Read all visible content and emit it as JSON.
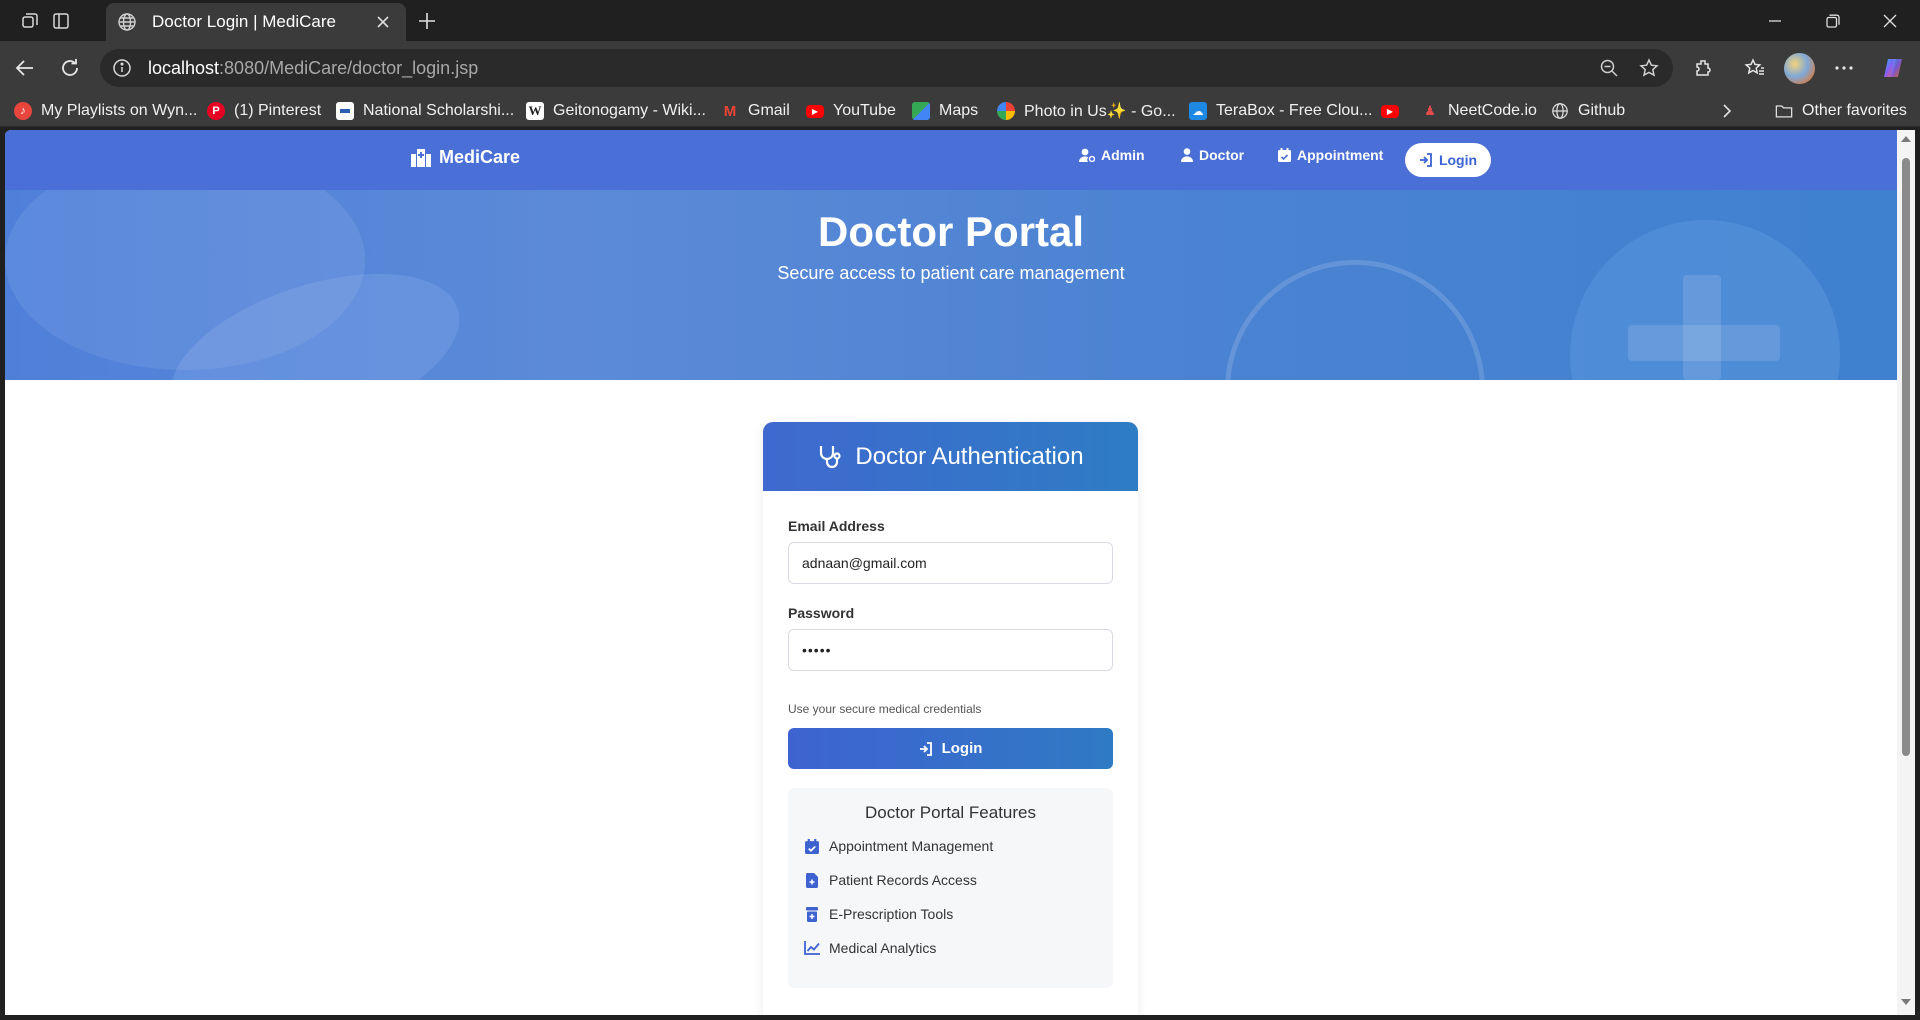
{
  "browser": {
    "tab_title": "Doctor Login | MediCare",
    "url_host": "localhost",
    "url_rest": ":8080/MediCare/doctor_login.jsp",
    "bookmarks": [
      {
        "label": "My Playlists on Wyn...",
        "icon": "playlist-icon",
        "color": "#e8453c"
      },
      {
        "label": "(1) Pinterest",
        "icon": "pinterest-icon",
        "color": "#e60023"
      },
      {
        "label": "National Scholarshi...",
        "icon": "scholarship-icon",
        "color": "#2b5fb4"
      },
      {
        "label": "Geitonogamy - Wiki...",
        "icon": "wikipedia-icon",
        "color": "#ffffff"
      },
      {
        "label": "Gmail",
        "icon": "gmail-icon",
        "color": "#ea4335"
      },
      {
        "label": "YouTube",
        "icon": "youtube-icon",
        "color": "#ff0000"
      },
      {
        "label": "Maps",
        "icon": "maps-icon",
        "color": "#34a853"
      },
      {
        "label": "Photo in Us✨ - Go...",
        "icon": "google-photos-icon",
        "color": "#fbbc04"
      },
      {
        "label": "TeraBox - Free Clou...",
        "icon": "terabox-icon",
        "color": "#1e88e5"
      },
      {
        "label": "",
        "icon": "youtube-icon",
        "color": "#ff0000"
      },
      {
        "label": "NeetCode.io",
        "icon": "neetcode-icon",
        "color": "#e34b4b"
      },
      {
        "label": "Github",
        "icon": "globe-icon",
        "color": "#dddddd"
      }
    ],
    "other_favorites": "Other favorites"
  },
  "site": {
    "brand": "MediCare",
    "nav": {
      "admin": "Admin",
      "doctor": "Doctor",
      "appointment": "Appointment",
      "login": "Login"
    },
    "hero": {
      "title": "Doctor Portal",
      "subtitle": "Secure access to patient care management"
    },
    "card": {
      "title": "Doctor Authentication",
      "email_label": "Email Address",
      "email_value": "adnaan@gmail.com",
      "password_label": "Password",
      "password_value": "•••••",
      "hint": "Use your secure medical credentials",
      "login_button": "Login",
      "features_title": "Doctor Portal Features",
      "features": [
        {
          "label": "Appointment Management",
          "icon": "calendar-check-icon"
        },
        {
          "label": "Patient Records Access",
          "icon": "file-medical-icon"
        },
        {
          "label": "E-Prescription Tools",
          "icon": "prescription-bottle-icon"
        },
        {
          "label": "Medical Analytics",
          "icon": "chart-line-icon"
        }
      ]
    }
  },
  "colors": {
    "nav_blue": "#4a6fd6",
    "accent_blue": "#3e63d1",
    "hero_blue": "#4f80d9"
  }
}
